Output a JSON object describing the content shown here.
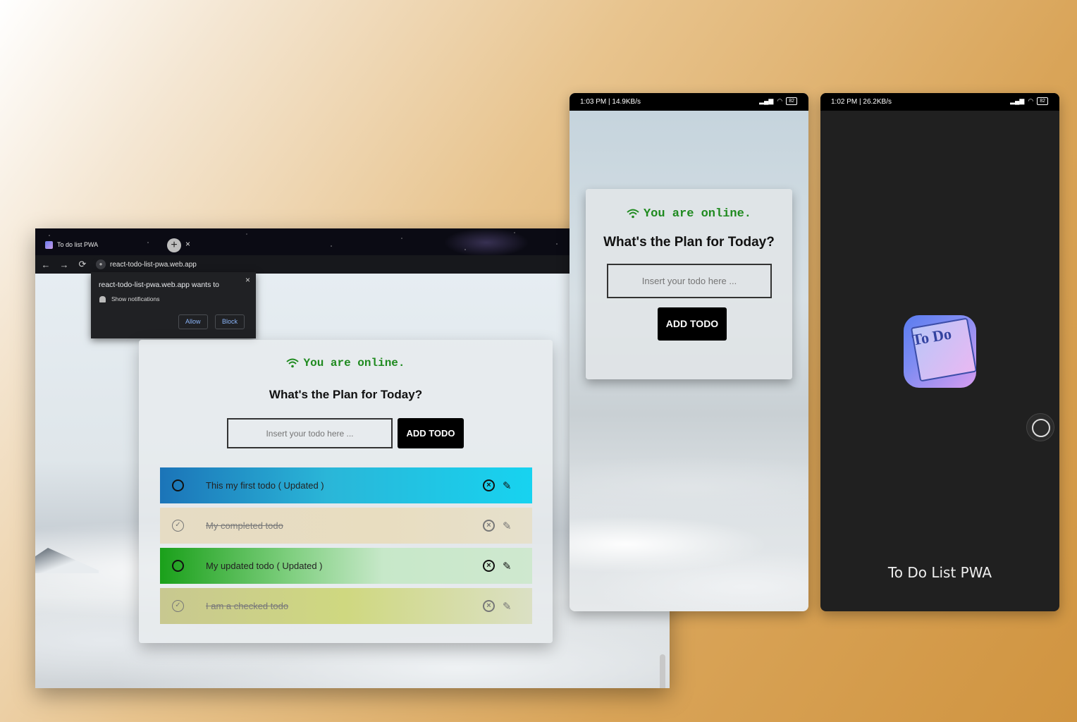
{
  "browser": {
    "tab_title": "To do list PWA",
    "tab_close": "×",
    "new_tab": "+",
    "url": "react-todo-list-pwa.web.app",
    "nav": {
      "back": "←",
      "forward": "→",
      "reload": "⟳"
    }
  },
  "notification": {
    "title": "react-todo-list-pwa.web.app wants to",
    "permission": "Show notifications",
    "allow": "Allow",
    "block": "Block",
    "close": "×"
  },
  "app": {
    "status": "You are online.",
    "heading": "What's the Plan for Today?",
    "input_placeholder": "Insert your todo here ...",
    "add_button": "ADD TODO",
    "todos": [
      {
        "text": "This my first todo ( Updated )",
        "completed": false
      },
      {
        "text": "My completed todo",
        "completed": true
      },
      {
        "text": "My updated todo ( Updated )",
        "completed": false
      },
      {
        "text": "I am a checked todo",
        "completed": true
      }
    ]
  },
  "phone1": {
    "status_time": "1:03 PM | 14.9KB/s",
    "battery": "82"
  },
  "phone2": {
    "status_time": "1:02 PM | 26.2KB/s",
    "battery": "82",
    "icon_text": "To Do",
    "app_name": "To Do List PWA"
  },
  "colors": {
    "online_green": "#1f8a1f",
    "button_black": "#000000",
    "splash_bg": "#202020"
  }
}
